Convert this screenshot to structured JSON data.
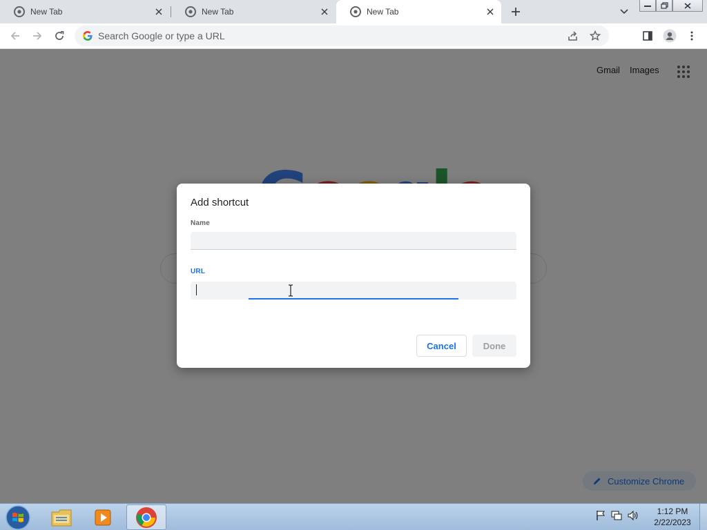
{
  "browser": {
    "tabs": [
      {
        "title": "New Tab",
        "active": false
      },
      {
        "title": "New Tab",
        "active": false
      },
      {
        "title": "New Tab",
        "active": true
      }
    ],
    "omnibox": {
      "placeholder": "Search Google or type a URL",
      "value": ""
    }
  },
  "page": {
    "top_links": [
      "Gmail",
      "Images"
    ],
    "logo_letters": [
      "G",
      "o",
      "o",
      "g",
      "l",
      "e"
    ],
    "logo_colors": [
      "#4285f4",
      "#ea4335",
      "#fbbc05",
      "#4285f4",
      "#34a853",
      "#ea4335"
    ],
    "customize_label": "Customize Chrome"
  },
  "dialog": {
    "title": "Add shortcut",
    "name_label": "Name",
    "name_value": "",
    "url_label": "URL",
    "url_value": "",
    "cancel_label": "Cancel",
    "done_label": "Done"
  },
  "taskbar": {
    "time": "1:12 PM",
    "date": "2/22/2023",
    "pinned": [
      "file-explorer",
      "media-player",
      "chrome"
    ]
  },
  "colors": {
    "accent": "#1a73e8",
    "tabstrip": "#dee1e6",
    "overlay": "rgba(0,0,0,0.5)"
  }
}
